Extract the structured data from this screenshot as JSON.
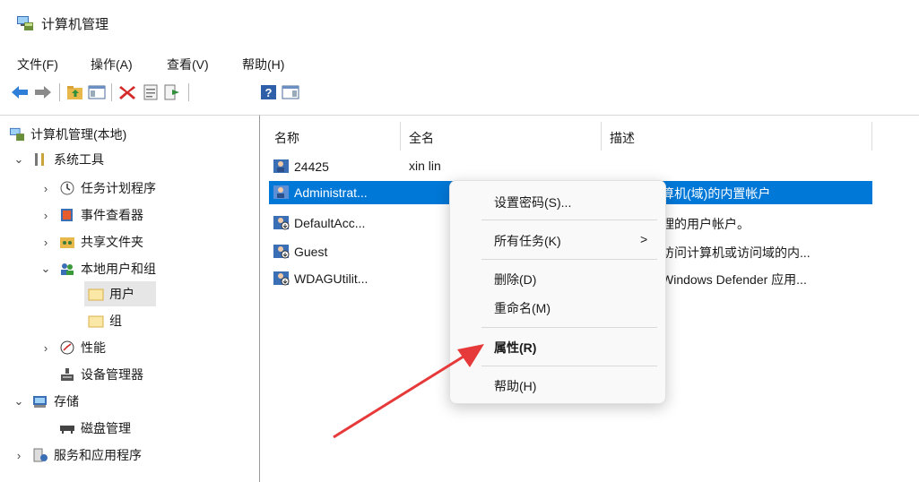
{
  "app": {
    "title": "计算机管理"
  },
  "menu": [
    "文件(F)",
    "操作(A)",
    "查看(V)",
    "帮助(H)"
  ],
  "tree": {
    "root": "计算机管理(本地)",
    "system_tools": "系统工具",
    "task_scheduler": "任务计划程序",
    "event_viewer": "事件查看器",
    "shared_folders": "共享文件夹",
    "local_users_groups": "本地用户和组",
    "users": "用户",
    "groups": "组",
    "performance": "性能",
    "device_manager": "设备管理器",
    "storage": "存储",
    "disk_management": "磁盘管理",
    "services_apps": "服务和应用程序"
  },
  "columns": {
    "name": "名称",
    "fullname": "全名",
    "description": "描述"
  },
  "users": [
    {
      "name": "24425",
      "fullname": "xin lin",
      "description": ""
    },
    {
      "name": "Administrat...",
      "fullname": "",
      "description": "算机(域)的内置帐户"
    },
    {
      "name": "DefaultAcc...",
      "fullname": "",
      "description": "理的用户帐户。"
    },
    {
      "name": "Guest",
      "fullname": "",
      "description": "访问计算机或访问域的内..."
    },
    {
      "name": "WDAGUtilit...",
      "fullname": "",
      "description": "Windows Defender 应用..."
    }
  ],
  "context_menu": {
    "set_password": "设置密码(S)...",
    "all_tasks": "所有任务(K)",
    "submenu_arrow": ">",
    "delete": "删除(D)",
    "rename": "重命名(M)",
    "properties": "属性(R)",
    "help": "帮助(H)"
  },
  "colors": {
    "selection": "#0078d7",
    "arrow": "#e63a3a"
  }
}
